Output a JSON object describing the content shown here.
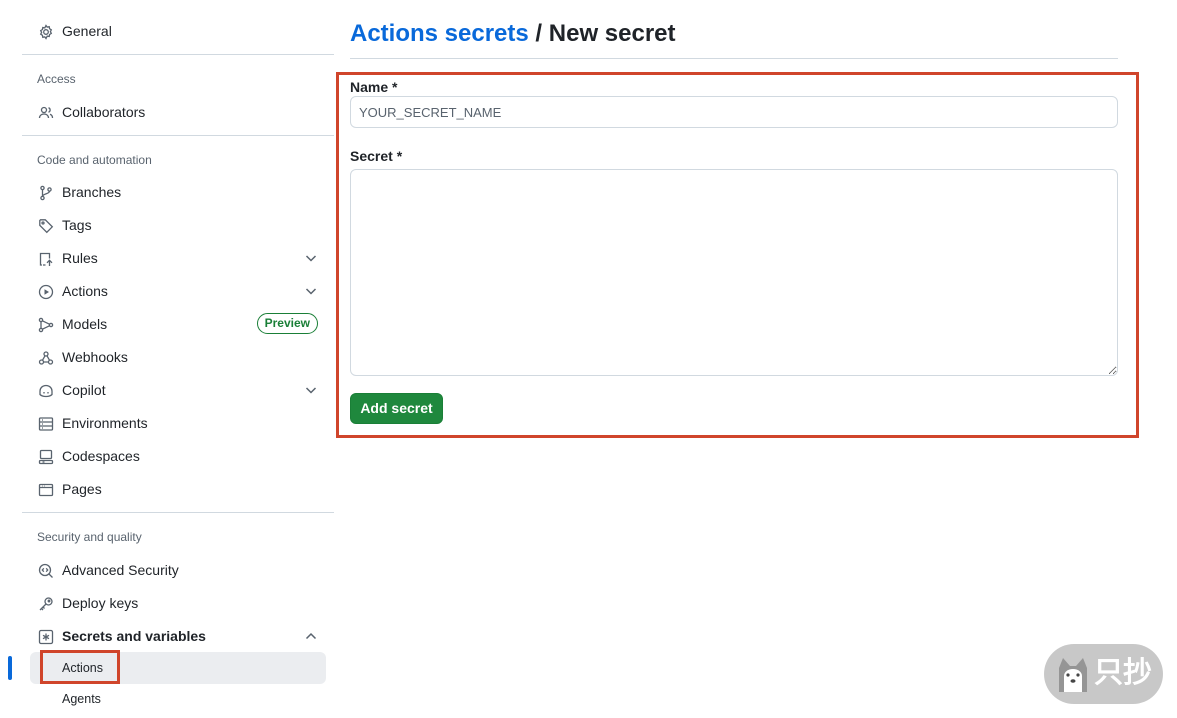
{
  "sidebar": {
    "general": "General",
    "sections": {
      "access": "Access",
      "code": "Code and automation",
      "security": "Security and quality"
    },
    "items": {
      "collaborators": "Collaborators",
      "branches": "Branches",
      "tags": "Tags",
      "rules": "Rules",
      "actions": "Actions",
      "models": "Models",
      "models_badge": "Preview",
      "webhooks": "Webhooks",
      "copilot": "Copilot",
      "environments": "Environments",
      "codespaces": "Codespaces",
      "pages": "Pages",
      "advanced_security": "Advanced Security",
      "deploy_keys": "Deploy keys",
      "secrets_and_variables": "Secrets and variables"
    },
    "sub_items": {
      "actions": "Actions",
      "agents": "Agents"
    }
  },
  "main": {
    "breadcrumb_link": "Actions secrets",
    "breadcrumb_separator": "/",
    "title": "New secret",
    "name_label": "Name *",
    "name_placeholder": "YOUR_SECRET_NAME",
    "secret_label": "Secret *",
    "submit_label": "Add secret"
  },
  "watermark": {
    "text": "只抄"
  },
  "colors": {
    "link": "#0969da",
    "primary_button": "#1f883d",
    "highlight": "#d0452b",
    "badge": "#1a7f37"
  }
}
